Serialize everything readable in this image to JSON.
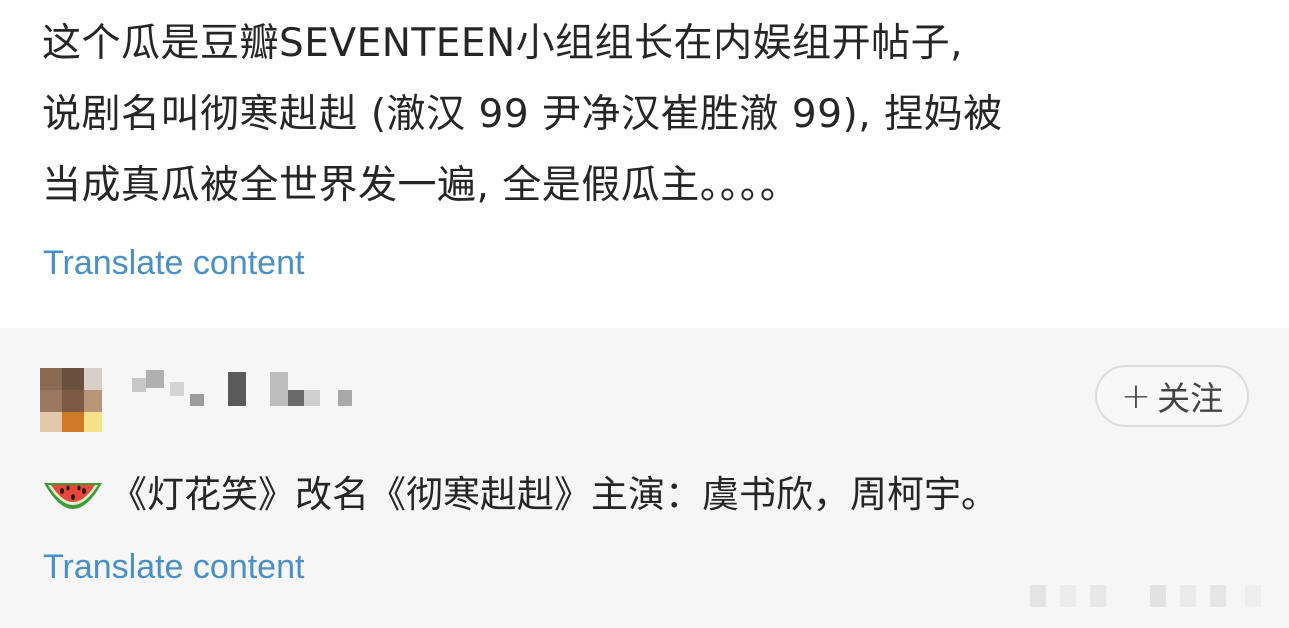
{
  "post": {
    "lines": [
      "这个瓜是豆瓣SEVENTEEN小组组长在内娱组开帖子,",
      "说剧名叫彻寒赳赳 (澈汉 99 尹净汉崔胜澈 99), 捏妈被",
      "当成真瓜被全世界发一遍, 全是假瓜主。。。。"
    ],
    "translate_label": "Translate content"
  },
  "repost": {
    "follow_label": "关注",
    "follow_plus": "+",
    "comment_text": "《灯花笑》改名《彻寒赳赳》主演：虞书欣，周柯宇。",
    "comment_emoji_icon": "watermelon-icon",
    "translate_label": "Translate content"
  },
  "colors": {
    "link": "#4a8fc7",
    "text": "#262626",
    "repost_bg": "#f6f6f6"
  }
}
